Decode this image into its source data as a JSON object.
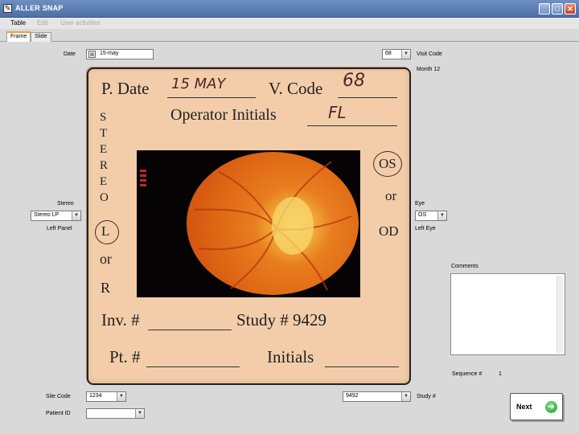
{
  "window": {
    "title": "ALLER SNAP"
  },
  "menu": [
    "Table",
    "Edit",
    "User activities"
  ],
  "tabs": [
    "Frame",
    "Slide"
  ],
  "form": {
    "date_label": "Date",
    "date_value": "15-may",
    "visit_value": "68",
    "visit_label": "Visit Code",
    "month_label": "Month 12",
    "stereo_label": "Stereo",
    "stereo_value": "Stereo LP",
    "left_panel_label": "Left Panel",
    "eye_label": "Eye",
    "eye_value": "OS",
    "left_eye_label": "Left Eye",
    "comments_label": "Comments",
    "comments_value": "",
    "sequence_label": "Sequence #",
    "sequence_value": "1",
    "site_code_label": "Site Code",
    "site_code_value": "1234",
    "patient_id_label": "Patient ID",
    "patient_id_value": "",
    "study_value": "9492",
    "study_label": "Study #",
    "next_label": "Next",
    "next_icon": "arrow-right-icon"
  },
  "slide": {
    "p_date": "P. Date",
    "p_date_hand": "15 MAY",
    "v_code": "V. Code",
    "v_code_hand": "68",
    "operator": "Operator Initials",
    "operator_hand": "FL",
    "stereo_letters": [
      "S",
      "T",
      "E",
      "R",
      "E",
      "O"
    ],
    "l_mark": "L",
    "or_1": "or",
    "r_mark": "R",
    "os": "OS",
    "or_2": "or",
    "od": "OD",
    "inv": "Inv. #",
    "study": "Study # 9429",
    "pt": "Pt. #",
    "initials": "Initials"
  },
  "colors": {
    "title_bar": "#4f6fa5",
    "slide": "#f3cdaa",
    "fundus": "#e87e1f",
    "accent_tab": "#e8a33a"
  }
}
